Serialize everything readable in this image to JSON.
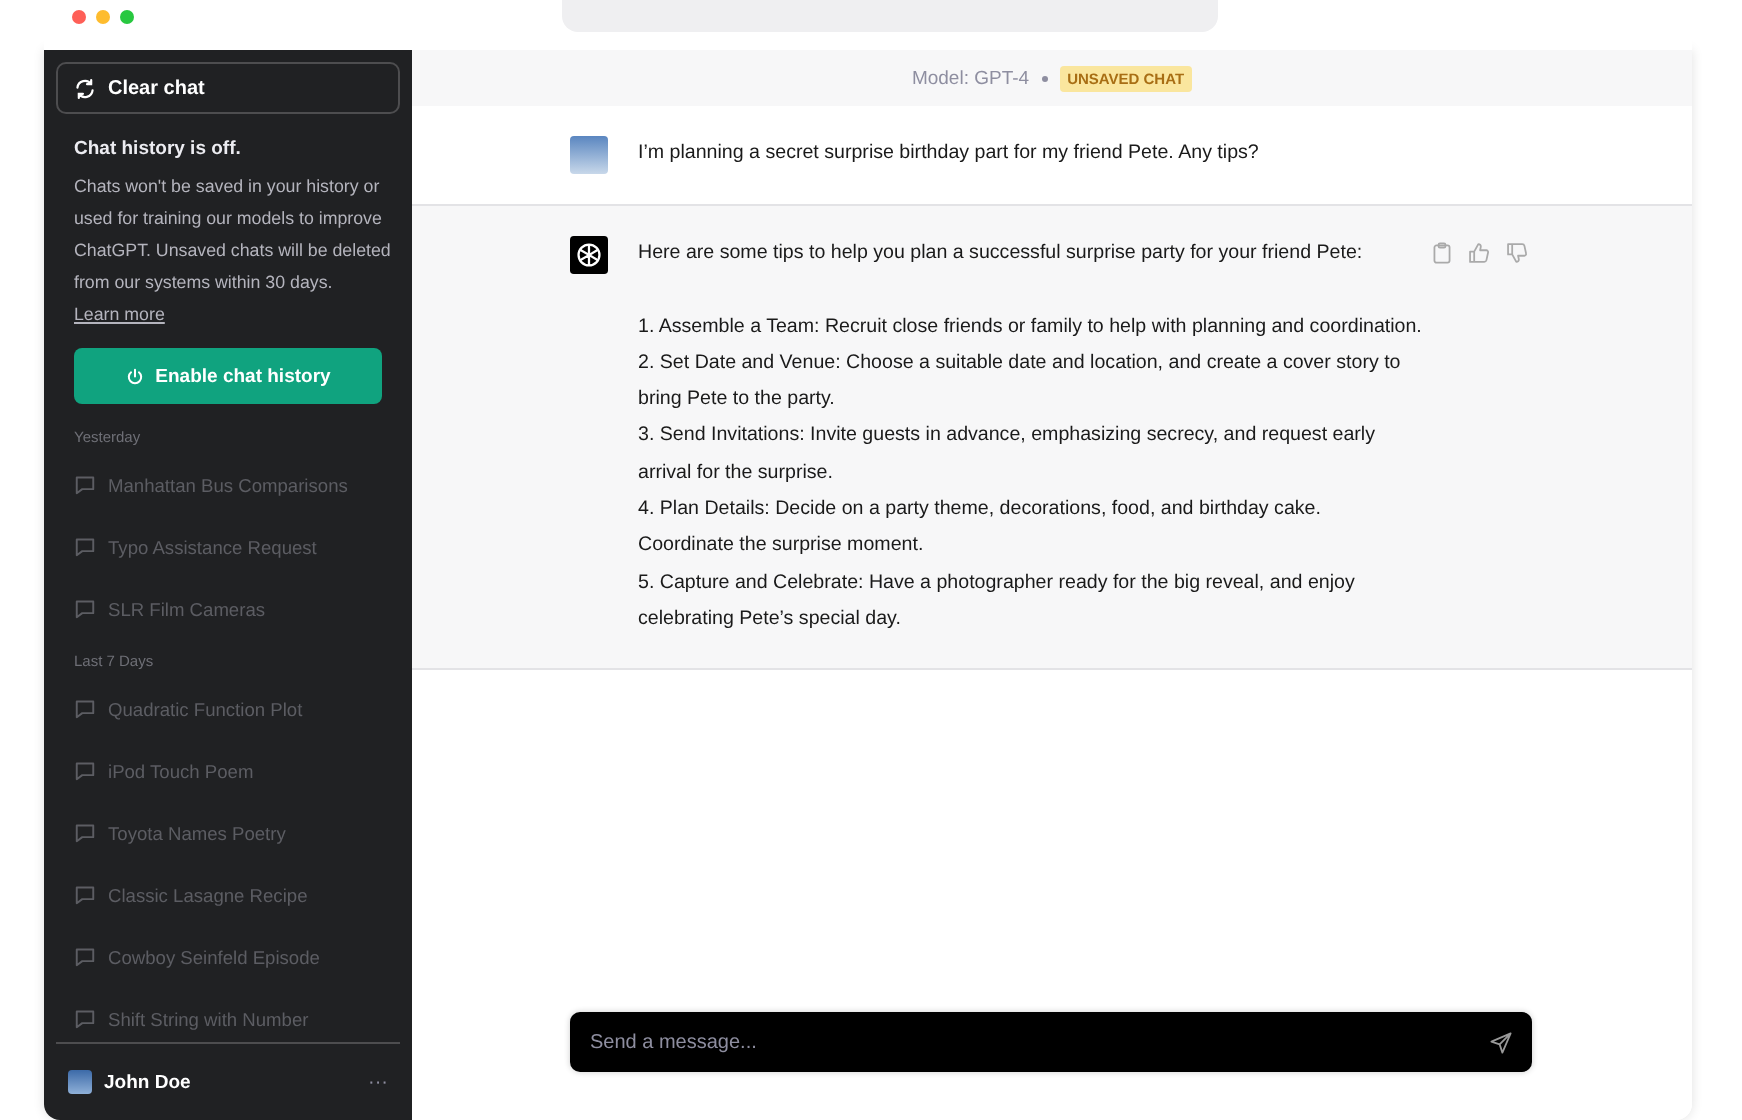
{
  "sidebar": {
    "clear_button": "Clear chat",
    "history_notice": {
      "title": "Chat history is off.",
      "body": "Chats won't be saved in your history or used for training our models to improve ChatGPT. Unsaved chats will be deleted from our systems within 30 days.",
      "link": "Learn more"
    },
    "enable_button": "Enable chat history",
    "sections": [
      {
        "label": "Yesterday",
        "items": [
          {
            "title": "Manhattan Bus Comparisons",
            "disabled": true
          },
          {
            "title": "Typo Assistance Request",
            "disabled": true
          },
          {
            "title": "SLR Film Cameras",
            "disabled": true
          }
        ]
      },
      {
        "label": "Last 7 Days",
        "items": [
          {
            "title": "Quadratic Function Plot",
            "disabled": true
          },
          {
            "title": "iPod Touch Poem",
            "disabled": true
          },
          {
            "title": "Toyota Names Poetry",
            "disabled": true
          },
          {
            "title": "Classic Lasagne Recipe",
            "disabled": true
          },
          {
            "title": "Cowboy Seinfeld Episode",
            "disabled": true
          },
          {
            "title": "Shift String with Number",
            "disabled": true
          }
        ]
      }
    ],
    "user": {
      "name": "John Doe",
      "menu": "···"
    }
  },
  "header": {
    "model": "Model: GPT-4",
    "badge": "UNSAVED CHAT"
  },
  "messages": [
    {
      "kind": "user",
      "paragraphs": [
        "I’m planning a secret surprise birthday part for my friend Pete. Any tips?"
      ]
    },
    {
      "kind": "assistant",
      "paragraphs": [
        "Here are some tips to help you plan a successful surprise party for your friend Pete:",
        "1. Assemble a Team: Recruit close friends or family to help with planning and coordination.",
        "2. Set Date and Venue: Choose a suitable date and location, and create a cover story to bring Pete to the party.",
        "3. Send Invitations: Invite guests in advance, emphasizing secrecy, and request early arrival for the surprise.",
        "4. Plan Details: Decide on a party theme, decorations, food, and birthday cake. Coordinate the surprise moment.",
        "5. Capture and Celebrate: Have a photographer ready for the big reveal, and enjoy celebrating Pete’s special day."
      ]
    }
  ],
  "composer": {
    "placeholder": "Send a message..."
  }
}
